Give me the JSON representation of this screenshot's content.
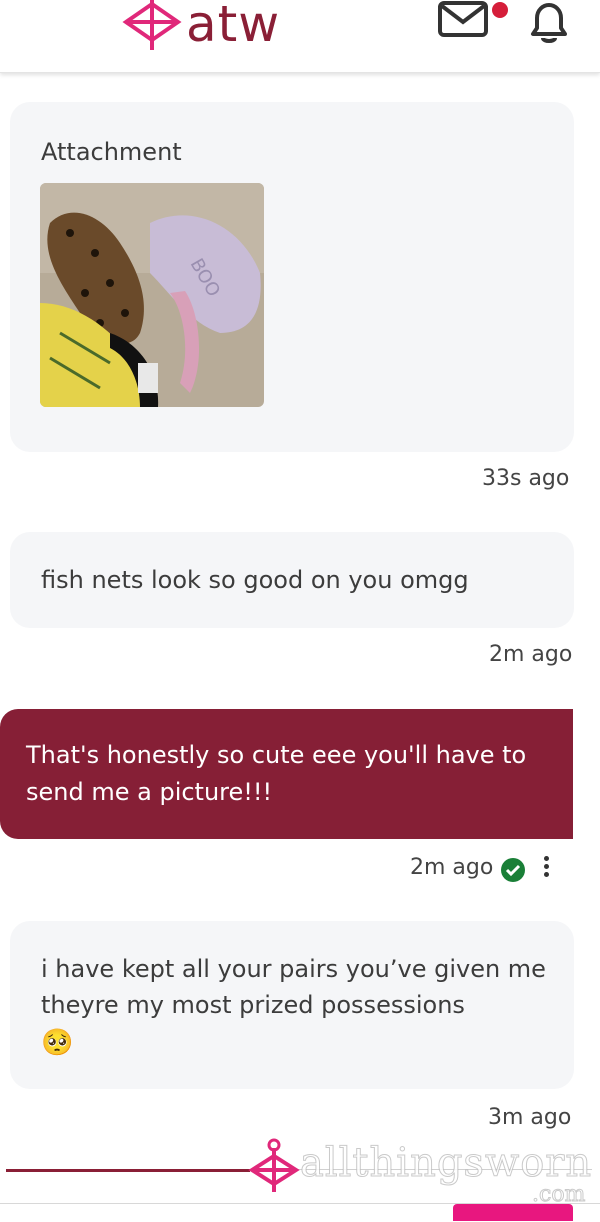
{
  "header": {
    "brand": "atw",
    "brand_color": "#8a1f36",
    "icons": [
      "logo-icon",
      "mail-icon",
      "bell-icon"
    ],
    "notification_dot_color": "#d51e3a"
  },
  "messages": [
    {
      "type": "incoming",
      "attachment_label": "Attachment",
      "time": "33s ago"
    },
    {
      "type": "incoming",
      "text": "fish nets look so good on you omgg",
      "time": "2m ago"
    },
    {
      "type": "outgoing",
      "text": "That's honestly so cute eee you'll have to send me a picture!!!",
      "time": "2m ago",
      "status": "read"
    },
    {
      "type": "incoming",
      "text": "i have kept all your pairs you’ve given me theyre my most prized possessions",
      "emoji": "🥺",
      "time": "3m ago"
    }
  ],
  "colors": {
    "outgoing_bubble": "#861f36",
    "incoming_bubble": "#f5f6f8",
    "send_button": "#e8177f",
    "read_check": "#1a7f37"
  },
  "footer": {
    "watermark": "allthingsworn",
    "watermark_suffix": ".com"
  }
}
